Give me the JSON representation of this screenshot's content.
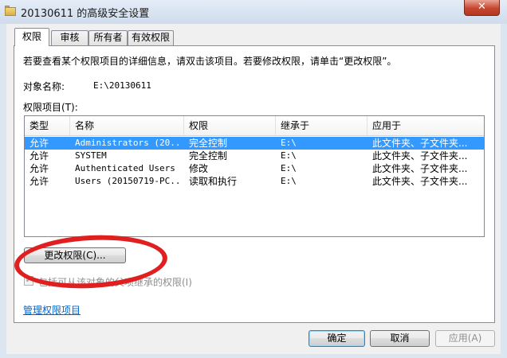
{
  "window": {
    "title": "20130611 的高级安全设置",
    "close_glyph": "✕"
  },
  "tabs": [
    {
      "label": "权限"
    },
    {
      "label": "审核"
    },
    {
      "label": "所有者"
    },
    {
      "label": "有效权限"
    }
  ],
  "permissions": {
    "instruction": "若要查看某个权限项目的详细信息，请双击该项目。若要修改权限，请单击“更改权限”。",
    "object_label": "对象名称:",
    "object_value": "E:\\20130611",
    "entries_label": "权限项目(T):",
    "columns": [
      "类型",
      "名称",
      "权限",
      "继承于",
      "应用于"
    ],
    "rows": [
      {
        "type": "允许",
        "name": "Administrators (20...",
        "permission": "完全控制",
        "inherited": "E:\\",
        "applies": "此文件夹、子文件夹...",
        "selected": true
      },
      {
        "type": "允许",
        "name": "SYSTEM",
        "permission": "完全控制",
        "inherited": "E:\\",
        "applies": "此文件夹、子文件夹..."
      },
      {
        "type": "允许",
        "name": "Authenticated Users",
        "permission": "修改",
        "inherited": "E:\\",
        "applies": "此文件夹、子文件夹..."
      },
      {
        "type": "允许",
        "name": "Users (20150719-PC...",
        "permission": "读取和执行",
        "inherited": "E:\\",
        "applies": "此文件夹、子文件夹..."
      }
    ],
    "change_button": "更改权限(C)...",
    "include_inheritable": "包括可从该对象的父项继承的权限(I)",
    "manage_link": "管理权限项目"
  },
  "footer": {
    "ok": "确定",
    "cancel": "取消",
    "apply": "应用(A)"
  },
  "colors": {
    "selection": "#3399ff",
    "annotation": "#e02020",
    "link": "#0066cc"
  }
}
